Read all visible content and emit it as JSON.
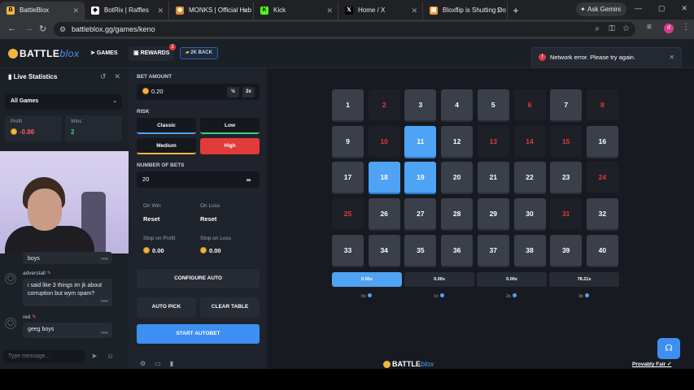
{
  "browser": {
    "tabs": [
      {
        "title": "BattleBlox",
        "fav_color": "#f2b63c",
        "fav_glyph": "B",
        "active": true
      },
      {
        "title": "BotRix | Raffles",
        "fav_color": "#ffffff",
        "fav_glyph": "◆",
        "active": false
      },
      {
        "title": "MONKS | Official Hub",
        "fav_color": "#e08a2a",
        "fav_glyph": "◉",
        "active": false
      },
      {
        "title": "Kick",
        "fav_color": "#53fc18",
        "fav_glyph": "K",
        "active": false
      },
      {
        "title": "Home / X",
        "fav_color": "#000000",
        "fav_glyph": "𝕏",
        "active": false
      },
      {
        "title": "Bloxflip is Shutting Do",
        "fav_color": "#f0a030",
        "fav_glyph": "▣",
        "active": false
      }
    ],
    "new_tab_label": "+",
    "gemini_label": "Ask Gemini",
    "url": "battleblox.gg/games/keno",
    "profile_initial": "d"
  },
  "site": {
    "logo_text": "BATTLE",
    "logo_suffix": "blox",
    "nav": {
      "games_label": "GAMES",
      "rewards_label": "REWARDS",
      "rewards_badge": "1",
      "rakeback_label": "2K BACK"
    }
  },
  "toast": {
    "message": "Network error. Please try again."
  },
  "live_stats": {
    "title": "Live Statistics",
    "filter_value": "All Games",
    "profit_label": "Profit",
    "profit_value": "-0.86",
    "wins_label": "Wins",
    "wins_value": "2"
  },
  "chat": {
    "partial_message": "boys",
    "partial_time": "now",
    "messages": [
      {
        "user": "adverstall",
        "text": "i said like 3 things im jk about corruption but wym spam?",
        "time": "now"
      },
      {
        "user": "red",
        "text": "geeg boys",
        "time": "now"
      }
    ],
    "input_placeholder": "Type message..."
  },
  "bet_panel": {
    "bet_amount_label": "BET AMOUNT",
    "bet_amount_value": "0.20",
    "half_label": "½",
    "double_label": "2x",
    "risk_label": "RISK",
    "risk_options": [
      {
        "label": "Classic",
        "color": "#4ea3f5",
        "active": false
      },
      {
        "label": "Low",
        "color": "#3dd07a",
        "active": false
      },
      {
        "label": "Medium",
        "color": "#f2b63c",
        "active": false
      },
      {
        "label": "High",
        "color": "#e23b3b",
        "active": true
      }
    ],
    "num_bets_label": "NUMBER OF BETS",
    "num_bets_value": "20",
    "infinity_label": "∞",
    "on_win_label": "On Win",
    "on_win_value": "Reset",
    "on_loss_label": "On Loss",
    "on_loss_value": "Reset",
    "stop_profit_label": "Stop on Profit",
    "stop_profit_value": "0.00",
    "stop_loss_label": "Stop on Loss",
    "stop_loss_value": "0.00",
    "configure_auto_label": "CONFIGURE AUTO",
    "auto_pick_label": "AUTO PICK",
    "clear_table_label": "CLEAR TABLE",
    "start_autobet_label": "START AUTOBET"
  },
  "keno": {
    "tiles": [
      {
        "n": "1",
        "state": "normal"
      },
      {
        "n": "2",
        "state": "dark"
      },
      {
        "n": "3",
        "state": "normal"
      },
      {
        "n": "4",
        "state": "normal"
      },
      {
        "n": "5",
        "state": "normal"
      },
      {
        "n": "6",
        "state": "dark"
      },
      {
        "n": "7",
        "state": "normal"
      },
      {
        "n": "8",
        "state": "dark"
      },
      {
        "n": "9",
        "state": "normal"
      },
      {
        "n": "10",
        "state": "dark"
      },
      {
        "n": "11",
        "state": "selected"
      },
      {
        "n": "12",
        "state": "normal"
      },
      {
        "n": "13",
        "state": "dark"
      },
      {
        "n": "14",
        "state": "dark"
      },
      {
        "n": "15",
        "state": "dark"
      },
      {
        "n": "16",
        "state": "normal"
      },
      {
        "n": "17",
        "state": "normal"
      },
      {
        "n": "18",
        "state": "selected"
      },
      {
        "n": "19",
        "state": "selected"
      },
      {
        "n": "20",
        "state": "normal"
      },
      {
        "n": "21",
        "state": "normal"
      },
      {
        "n": "22",
        "state": "normal"
      },
      {
        "n": "23",
        "state": "normal"
      },
      {
        "n": "24",
        "state": "dark"
      },
      {
        "n": "25",
        "state": "dark"
      },
      {
        "n": "26",
        "state": "normal"
      },
      {
        "n": "27",
        "state": "normal"
      },
      {
        "n": "28",
        "state": "normal"
      },
      {
        "n": "29",
        "state": "normal"
      },
      {
        "n": "30",
        "state": "normal"
      },
      {
        "n": "31",
        "state": "dark"
      },
      {
        "n": "32",
        "state": "normal"
      },
      {
        "n": "33",
        "state": "normal"
      },
      {
        "n": "34",
        "state": "normal"
      },
      {
        "n": "35",
        "state": "normal"
      },
      {
        "n": "36",
        "state": "normal"
      },
      {
        "n": "37",
        "state": "normal"
      },
      {
        "n": "38",
        "state": "normal"
      },
      {
        "n": "39",
        "state": "normal"
      },
      {
        "n": "40",
        "state": "normal"
      }
    ],
    "payouts": [
      {
        "value": "0.00x",
        "hits": "0x",
        "active": true
      },
      {
        "value": "0.00x",
        "hits": "1x",
        "active": false
      },
      {
        "value": "0.00x",
        "hits": "2x",
        "active": false
      },
      {
        "value": "78.21x",
        "hits": "3x",
        "active": false
      }
    ],
    "footer_logo": "BATTLE",
    "footer_logo_suffix": "blox",
    "provably_fair_label": "Provably Fair"
  }
}
